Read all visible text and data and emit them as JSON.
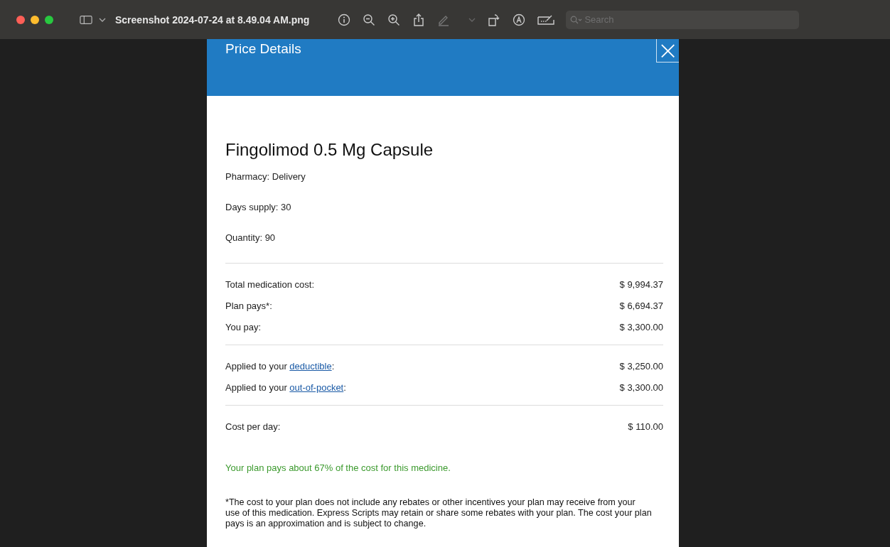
{
  "window": {
    "title": "Screenshot 2024-07-24 at 8.49.04 AM.png",
    "search": {
      "placeholder": "Search"
    }
  },
  "dialog": {
    "title": "Price Details",
    "close": "×"
  },
  "drug": {
    "name": "Fingolimod 0.5 Mg Capsule",
    "details": [
      "Pharmacy: Delivery",
      "Days supply: 30",
      "Quantity: 90"
    ]
  },
  "sections": [
    {
      "rows": [
        {
          "label": "Total medication cost:",
          "value": "$ 9,994.37"
        },
        {
          "label": "Plan pays*:",
          "value": "$ 6,694.37"
        },
        {
          "label": "You pay:",
          "value": "$ 3,300.00"
        }
      ]
    },
    {
      "rows": [
        {
          "label": "Applied to your ",
          "link": "deductible",
          "suffix": ":",
          "value": "$ 3,250.00"
        },
        {
          "label": "Applied to your ",
          "link": "out-of-pocket",
          "suffix": ":",
          "value": "$ 3,300.00"
        }
      ]
    },
    {
      "rows": [
        {
          "label": "Cost per day:",
          "value": "$ 110.00"
        }
      ]
    }
  ],
  "summary": "Your plan pays about 67% of the cost for this medicine.",
  "footnote": "*The cost to your plan does not include any rebates or other incentives your plan may receive from your use of this medication. Express Scripts may retain or share some rebates with your plan. The cost your plan pays is an approximation and is subject to change."
}
